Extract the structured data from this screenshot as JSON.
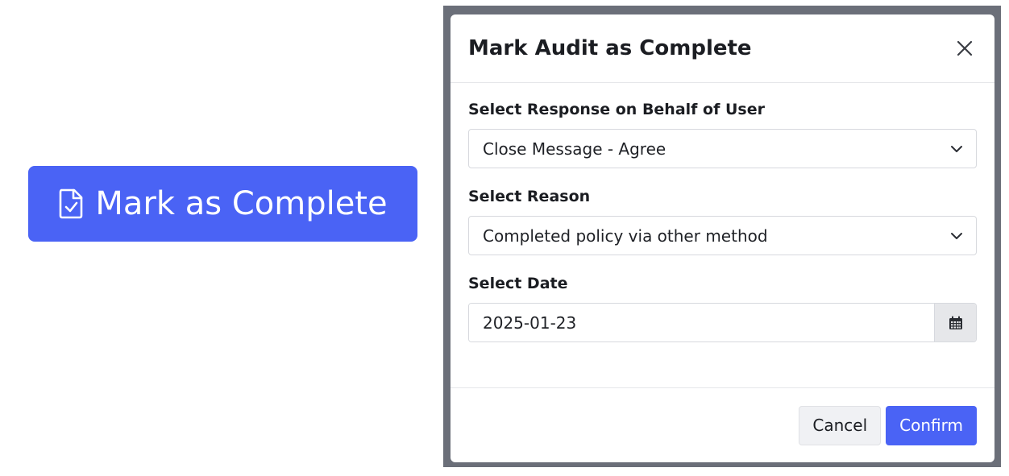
{
  "primary_button": {
    "label": "Mark as Complete",
    "icon": "document-check-icon",
    "color": "#4a63f5"
  },
  "modal": {
    "title": "Mark Audit as Complete",
    "fields": {
      "response": {
        "label": "Select Response on Behalf of User",
        "value": "Close Message - Agree"
      },
      "reason": {
        "label": "Select Reason",
        "value": "Completed policy via other method"
      },
      "date": {
        "label": "Select Date",
        "value": "2025-01-23"
      }
    },
    "footer": {
      "cancel_label": "Cancel",
      "confirm_label": "Confirm"
    }
  },
  "colors": {
    "accent": "#4a63f5",
    "backdrop": "#6b6f79"
  }
}
